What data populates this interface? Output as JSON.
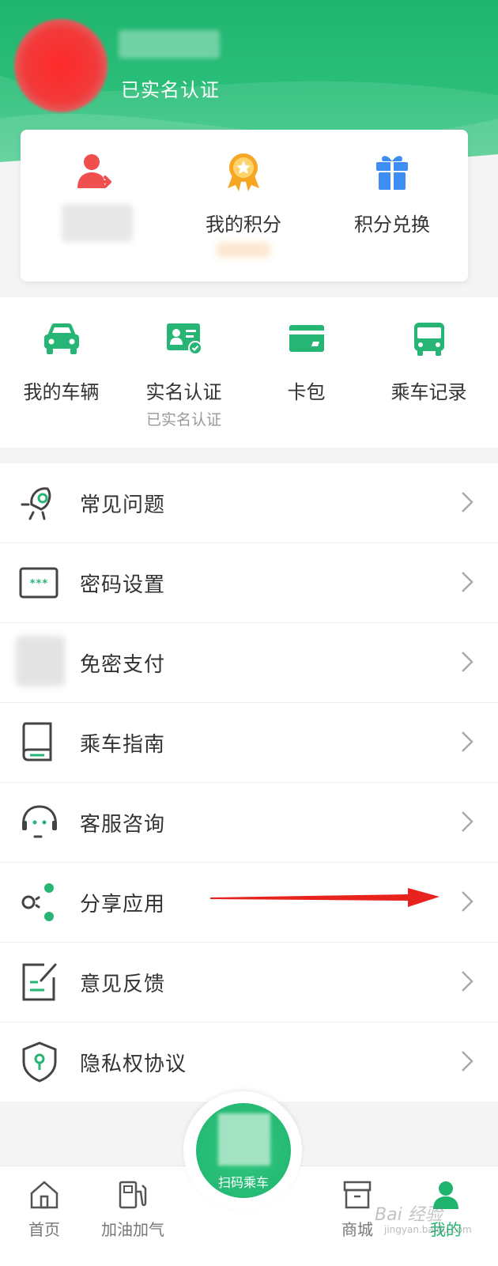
{
  "header": {
    "verified_label": "已实名认证"
  },
  "card": {
    "items": [
      {
        "label": "",
        "icon": "user-transfer-icon",
        "color": "#ef4f4f"
      },
      {
        "label": "我的积分",
        "icon": "medal-icon",
        "color": "#f5a623"
      },
      {
        "label": "积分兑换",
        "icon": "gift-icon",
        "color": "#3d8ef0"
      }
    ]
  },
  "shortcuts": [
    {
      "label": "我的车辆",
      "sub": "",
      "icon": "car-icon"
    },
    {
      "label": "实名认证",
      "sub": "已实名认证",
      "icon": "id-card-icon"
    },
    {
      "label": "卡包",
      "sub": "",
      "icon": "card-wallet-icon"
    },
    {
      "label": "乘车记录",
      "sub": "",
      "icon": "bus-icon"
    }
  ],
  "menu": [
    {
      "label": "常见问题",
      "icon": "faq-icon"
    },
    {
      "label": "密码设置",
      "icon": "password-icon"
    },
    {
      "label": "免密支付",
      "icon": "blurred-icon"
    },
    {
      "label": "乘车指南",
      "icon": "guide-book-icon"
    },
    {
      "label": "客服咨询",
      "icon": "customer-service-icon"
    },
    {
      "label": "分享应用",
      "icon": "share-icon"
    },
    {
      "label": "意见反馈",
      "icon": "feedback-icon"
    },
    {
      "label": "隐私权协议",
      "icon": "privacy-shield-icon"
    }
  ],
  "tabbar": {
    "tabs": [
      {
        "label": "首页",
        "icon": "home-icon"
      },
      {
        "label": "加油加气",
        "icon": "gas-station-icon"
      },
      {
        "label": "商城",
        "icon": "store-icon"
      },
      {
        "label": "我的",
        "icon": "profile-icon",
        "active": true
      }
    ],
    "scan_label": "扫码乘车"
  },
  "watermark": {
    "text": "Bai 经验",
    "sub": "jingyan.baidu.com"
  },
  "colors": {
    "brand_green": "#1fb56f",
    "annotation_red": "#e8231e"
  }
}
